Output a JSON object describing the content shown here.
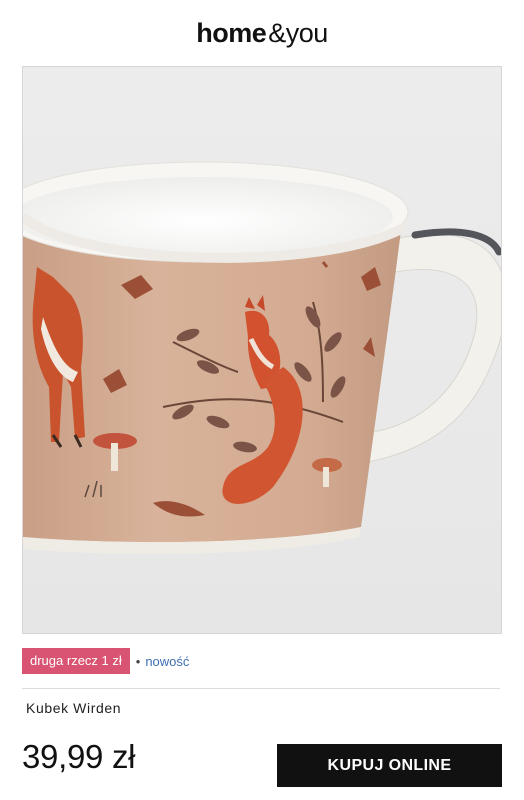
{
  "header": {
    "logo_bold": "home",
    "logo_amp": "&",
    "logo_light": "you"
  },
  "product": {
    "image_name": "mug-with-fox-and-squirrel-image",
    "promo_badge": "druga rzecz 1 zł",
    "separator": "•",
    "new_badge": "nowość",
    "name": "Kubek Wirden",
    "price": "39,99 zł",
    "buy_label": "KUPUJ ONLINE"
  },
  "colors": {
    "promo_badge_bg": "#d95472",
    "new_badge_text": "#3f6fb5",
    "button_bg": "#111111",
    "mug_body": "#d3ab91"
  }
}
